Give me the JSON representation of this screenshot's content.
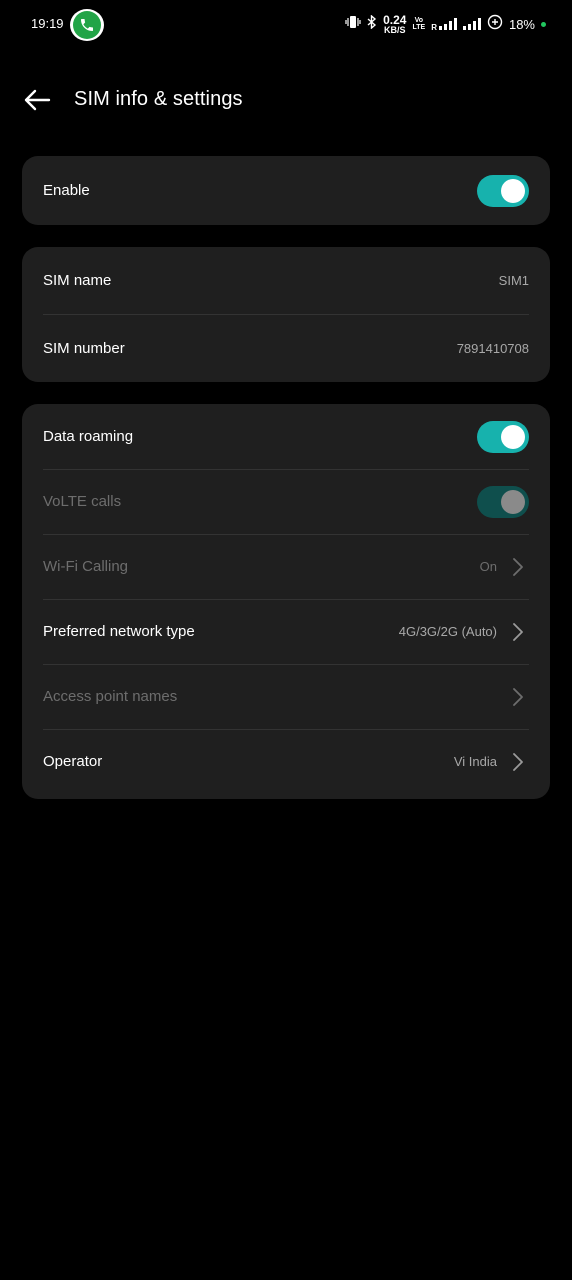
{
  "status_bar": {
    "time": "19:19",
    "speed_value": "0.24",
    "speed_unit": "KB/S",
    "volte_top": "Vo",
    "volte_bottom": "LTE",
    "roaming_indicator": "R",
    "battery": "18%",
    "colors": {
      "call_pill": "#22a447",
      "dot": "#21c65f"
    },
    "icons": [
      "phone-call-icon",
      "vibrate-icon",
      "bluetooth-icon",
      "signal-icon",
      "battery-saver-icon"
    ]
  },
  "header": {
    "title": "SIM info & settings",
    "back_icon": "arrow-left-icon"
  },
  "enable_card": {
    "label": "Enable",
    "toggle_on": true
  },
  "sim_card": {
    "rows": [
      {
        "label": "SIM name",
        "value": "SIM1"
      },
      {
        "label": "SIM number",
        "value": "7891410708"
      }
    ]
  },
  "network_card": {
    "rows": [
      {
        "label": "Data roaming",
        "type": "toggle",
        "on": true,
        "enabled": true
      },
      {
        "label": "VoLTE calls",
        "type": "toggle",
        "on": true,
        "enabled": false
      },
      {
        "label": "Wi-Fi Calling",
        "type": "link",
        "value": "On",
        "enabled": false
      },
      {
        "label": "Preferred network type",
        "type": "link",
        "value": "4G/3G/2G (Auto)",
        "enabled": true
      },
      {
        "label": "Access point names",
        "type": "link",
        "value": "",
        "enabled": false
      },
      {
        "label": "Operator",
        "type": "link",
        "value": "Vi India",
        "enabled": true
      }
    ]
  },
  "theme": {
    "accent": "#17b2ad",
    "card_bg": "#1f1f1f",
    "background": "#000000"
  }
}
